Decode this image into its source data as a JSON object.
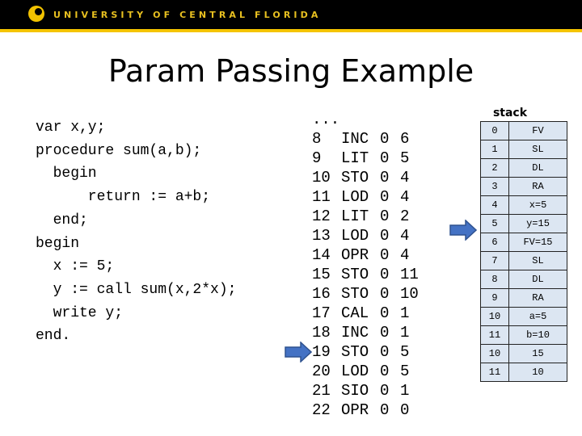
{
  "header": {
    "university": "UNIVERSITY OF CENTRAL FLORIDA",
    "brand_color": "#f5c400"
  },
  "slide": {
    "title": "Param Passing Example"
  },
  "source_code": [
    "var x,y;",
    "procedure sum(a,b);",
    "  begin",
    "      return := a+b;",
    "  end;",
    "begin",
    "  x := 5;",
    "  y := call sum(x,2*x);",
    "  write y;",
    "end."
  ],
  "code": {
    "ellipsis": "...",
    "rows": [
      [
        "8",
        "INC",
        "0",
        "6"
      ],
      [
        "9",
        "LIT",
        "0",
        "5"
      ],
      [
        "10",
        "STO",
        "0",
        "4"
      ],
      [
        "11",
        "LOD",
        "0",
        "4"
      ],
      [
        "12",
        "LIT",
        "0",
        "2"
      ],
      [
        "13",
        "LOD",
        "0",
        "4"
      ],
      [
        "14",
        "OPR",
        "0",
        "4"
      ],
      [
        "15",
        "STO",
        "0",
        "11"
      ],
      [
        "16",
        "STO",
        "0",
        "10"
      ],
      [
        "17",
        "CAL",
        "0",
        "1"
      ],
      [
        "18",
        "INC",
        "0",
        "1"
      ],
      [
        "19",
        "STO",
        "0",
        "5"
      ],
      [
        "20",
        "LOD",
        "0",
        "5"
      ],
      [
        "21",
        "SIO",
        "0",
        "1"
      ],
      [
        "22",
        "OPR",
        "0",
        "0"
      ]
    ]
  },
  "stack": {
    "title": "stack",
    "rows": [
      [
        "0",
        "FV"
      ],
      [
        "1",
        "SL"
      ],
      [
        "2",
        "DL"
      ],
      [
        "3",
        "RA"
      ],
      [
        "4",
        "x=5"
      ],
      [
        "5",
        "y=15"
      ],
      [
        "6",
        "FV=15"
      ],
      [
        "7",
        "SL"
      ],
      [
        "8",
        "DL"
      ],
      [
        "9",
        "RA"
      ],
      [
        "10",
        "a=5"
      ],
      [
        "11",
        "b=10"
      ],
      [
        "10",
        "15"
      ],
      [
        "11",
        "10"
      ]
    ]
  },
  "pointers": {
    "code_arrow_at": "19",
    "stack_arrow_at": "5",
    "arrow_color": "#4472c4"
  }
}
